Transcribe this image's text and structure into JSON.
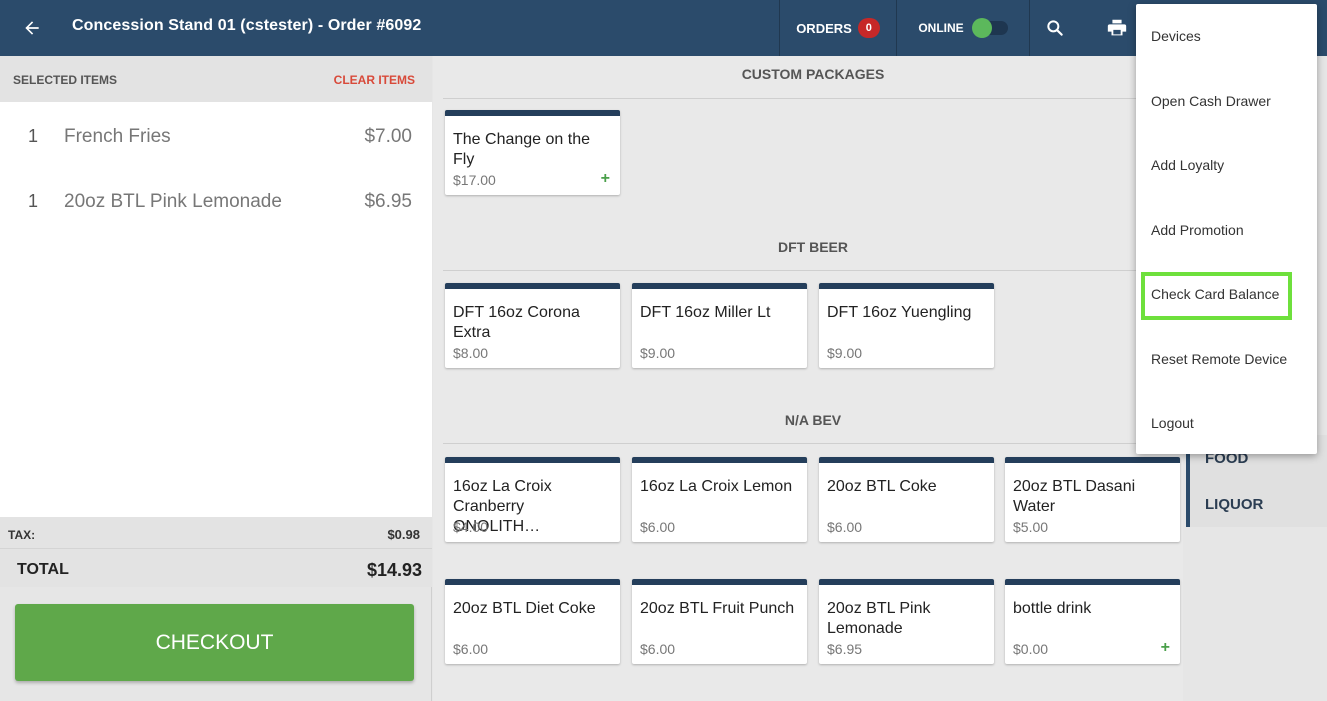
{
  "header": {
    "title": "Concession Stand 01 (cstester) - Order #6092",
    "orders_label": "ORDERS",
    "orders_count": "0",
    "online_label": "ONLINE"
  },
  "order": {
    "selected_label": "SELECTED ITEMS",
    "clear_label": "CLEAR ITEMS",
    "items": [
      {
        "qty": "1",
        "name": "French Fries",
        "price": "$7.00"
      },
      {
        "qty": "1",
        "name": "20oz BTL Pink Lemonade",
        "price": "$6.95"
      }
    ],
    "tax_label": "TAX:",
    "tax_value": "$0.98",
    "total_label": "TOTAL",
    "total_value": "$14.93",
    "checkout_label": "CHECKOUT"
  },
  "sections": [
    {
      "title": "CUSTOM PACKAGES",
      "products": [
        {
          "name": "The Change on the Fly",
          "price": "$17.00",
          "plus": "+"
        }
      ]
    },
    {
      "title": "DFT BEER",
      "products": [
        {
          "name": "DFT 16oz Corona Extra",
          "price": "$8.00"
        },
        {
          "name": "DFT 16oz Miller Lt",
          "price": "$9.00"
        },
        {
          "name": "DFT 16oz Yuengling",
          "price": "$9.00"
        }
      ]
    },
    {
      "title": "N/A BEV",
      "products": [
        {
          "name": "16oz La Croix Cranberry ONOLITH…",
          "price": "$4.00"
        },
        {
          "name": "16oz La Croix Lemon",
          "price": "$6.00"
        },
        {
          "name": "20oz BTL Coke",
          "price": "$6.00"
        },
        {
          "name": "20oz BTL Dasani Water",
          "price": "$5.00"
        },
        {
          "name": "20oz BTL Diet Coke",
          "price": "$6.00"
        },
        {
          "name": "20oz BTL Fruit Punch",
          "price": "$6.00"
        },
        {
          "name": "20oz BTL Pink Lemonade",
          "price": "$6.95"
        },
        {
          "name": "bottle drink",
          "price": "$0.00",
          "plus": "+"
        }
      ]
    }
  ],
  "categories": [
    "FOOD",
    "LIQUOR"
  ],
  "menu": {
    "items": [
      "Devices",
      "Open Cash Drawer",
      "Add Loyalty",
      "Add Promotion",
      "Check Card Balance",
      "Reset Remote Device",
      "Logout"
    ]
  },
  "colors": {
    "header": "#2b4b6b",
    "tile_bar": "#243e5b",
    "checkout": "#5fa84a",
    "clear": "#d84a3a",
    "highlight": "#6ee03c"
  }
}
